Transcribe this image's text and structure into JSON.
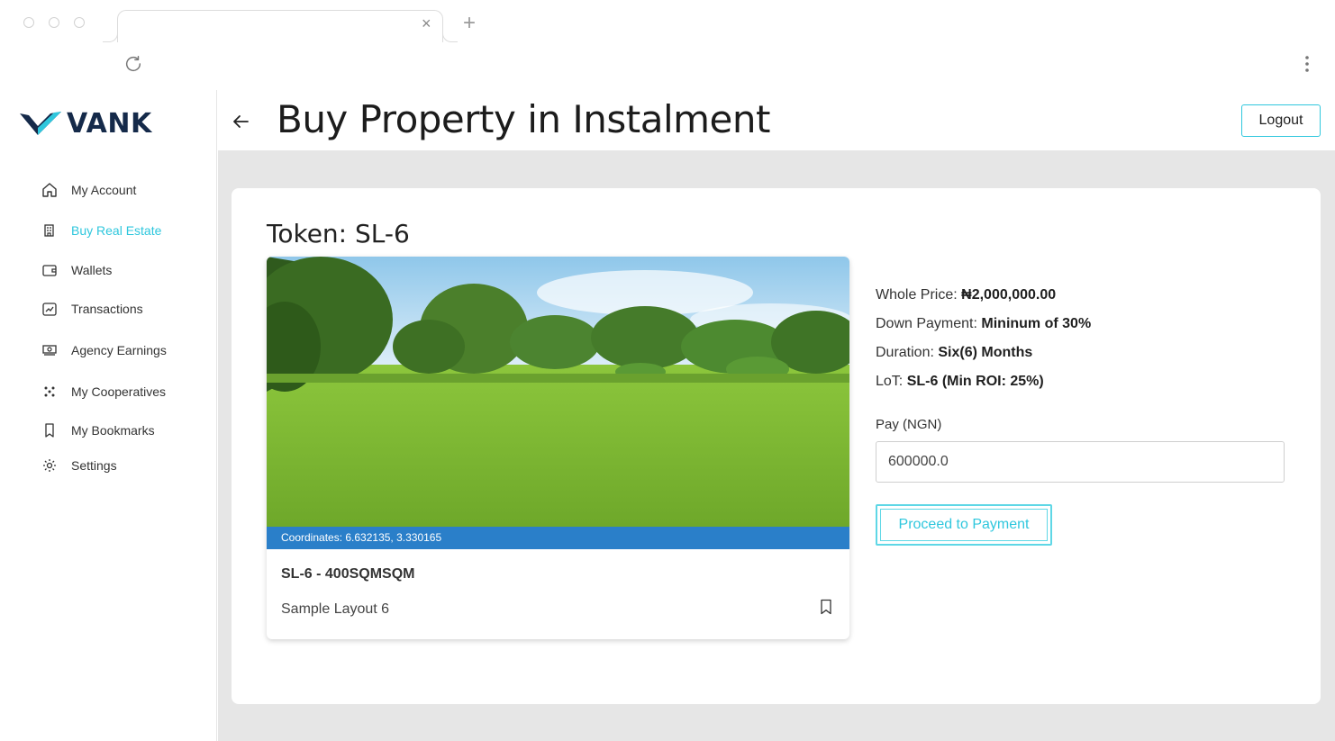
{
  "app": {
    "brand": "VANK",
    "accent_color": "#2fc7dd"
  },
  "sidebar": {
    "items": [
      {
        "label": "My Account",
        "icon": "home-icon"
      },
      {
        "label": "Buy Real Estate",
        "icon": "building-icon",
        "active": true
      },
      {
        "label": "Wallets",
        "icon": "wallet-icon"
      },
      {
        "label": "Transactions",
        "icon": "chart-icon"
      },
      {
        "label": "Agency Earnings",
        "icon": "money-icon"
      },
      {
        "label": "My Cooperatives",
        "icon": "people-icon"
      },
      {
        "label": "My Bookmarks",
        "icon": "bookmark-icon"
      },
      {
        "label": "Settings",
        "icon": "gear-icon"
      }
    ]
  },
  "header": {
    "title": "Buy Property in Instalment",
    "logout_label": "Logout"
  },
  "token": {
    "title": "Token: SL-6"
  },
  "property": {
    "coordinates": "Coordinates: 6.632135, 3.330165",
    "name": "SL-6 - 400SQMSQM",
    "subtitle": "Sample Layout 6"
  },
  "details": {
    "whole_price_label": "Whole Price:",
    "whole_price_value": "₦2,000,000.00",
    "down_payment_label": "Down Payment:",
    "down_payment_value": "Mininum of 30%",
    "duration_label": "Duration:",
    "duration_value": "Six(6) Months",
    "lot_label": "LoT:",
    "lot_value": "SL-6 (Min ROI: 25%)"
  },
  "payment": {
    "label": "Pay (NGN)",
    "value": "600000.0",
    "button_label": "Proceed to Payment"
  }
}
